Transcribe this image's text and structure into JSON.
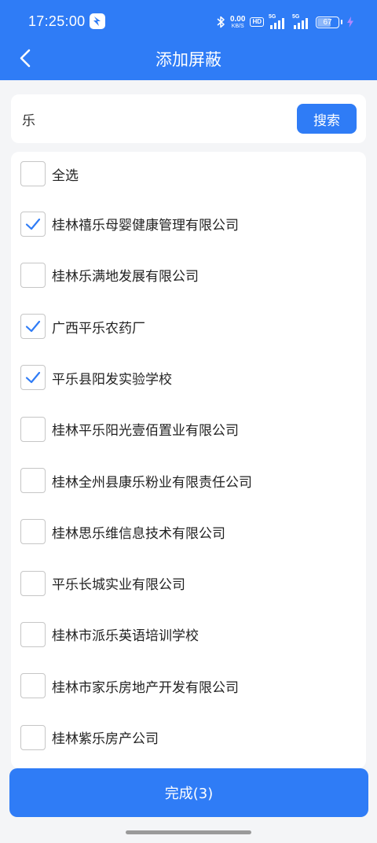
{
  "status_bar": {
    "time": "17:25:00",
    "net_speed_value": "0.00",
    "net_speed_unit": "KB/S",
    "hd_label": "HD",
    "signal1_label": "5G",
    "signal2_label": "5G",
    "battery_level": "67"
  },
  "nav": {
    "title": "添加屏蔽",
    "back_icon": "chevron-left-icon"
  },
  "search": {
    "value": "乐",
    "button_label": "搜索"
  },
  "select_all": {
    "label": "全选",
    "checked": false
  },
  "list": {
    "items": [
      {
        "label": "桂林禧乐母婴健康管理有限公司",
        "checked": true
      },
      {
        "label": "桂林乐满地发展有限公司",
        "checked": false
      },
      {
        "label": "广西平乐农药厂",
        "checked": true
      },
      {
        "label": "平乐县阳发实验学校",
        "checked": true
      },
      {
        "label": "桂林平乐阳光壹佰置业有限公司",
        "checked": false
      },
      {
        "label": "桂林全州县康乐粉业有限责任公司",
        "checked": false
      },
      {
        "label": "桂林思乐维信息技术有限公司",
        "checked": false
      },
      {
        "label": "平乐长城实业有限公司",
        "checked": false
      },
      {
        "label": "桂林市派乐英语培训学校",
        "checked": false
      },
      {
        "label": "桂林市家乐房地产开发有限公司",
        "checked": false
      },
      {
        "label": "桂林紫乐房产公司",
        "checked": false
      }
    ]
  },
  "done": {
    "label": "完成(3)"
  },
  "colors": {
    "accent": "#2f7cf6",
    "check": "#2f7cf6",
    "background": "#f4f5f7"
  }
}
